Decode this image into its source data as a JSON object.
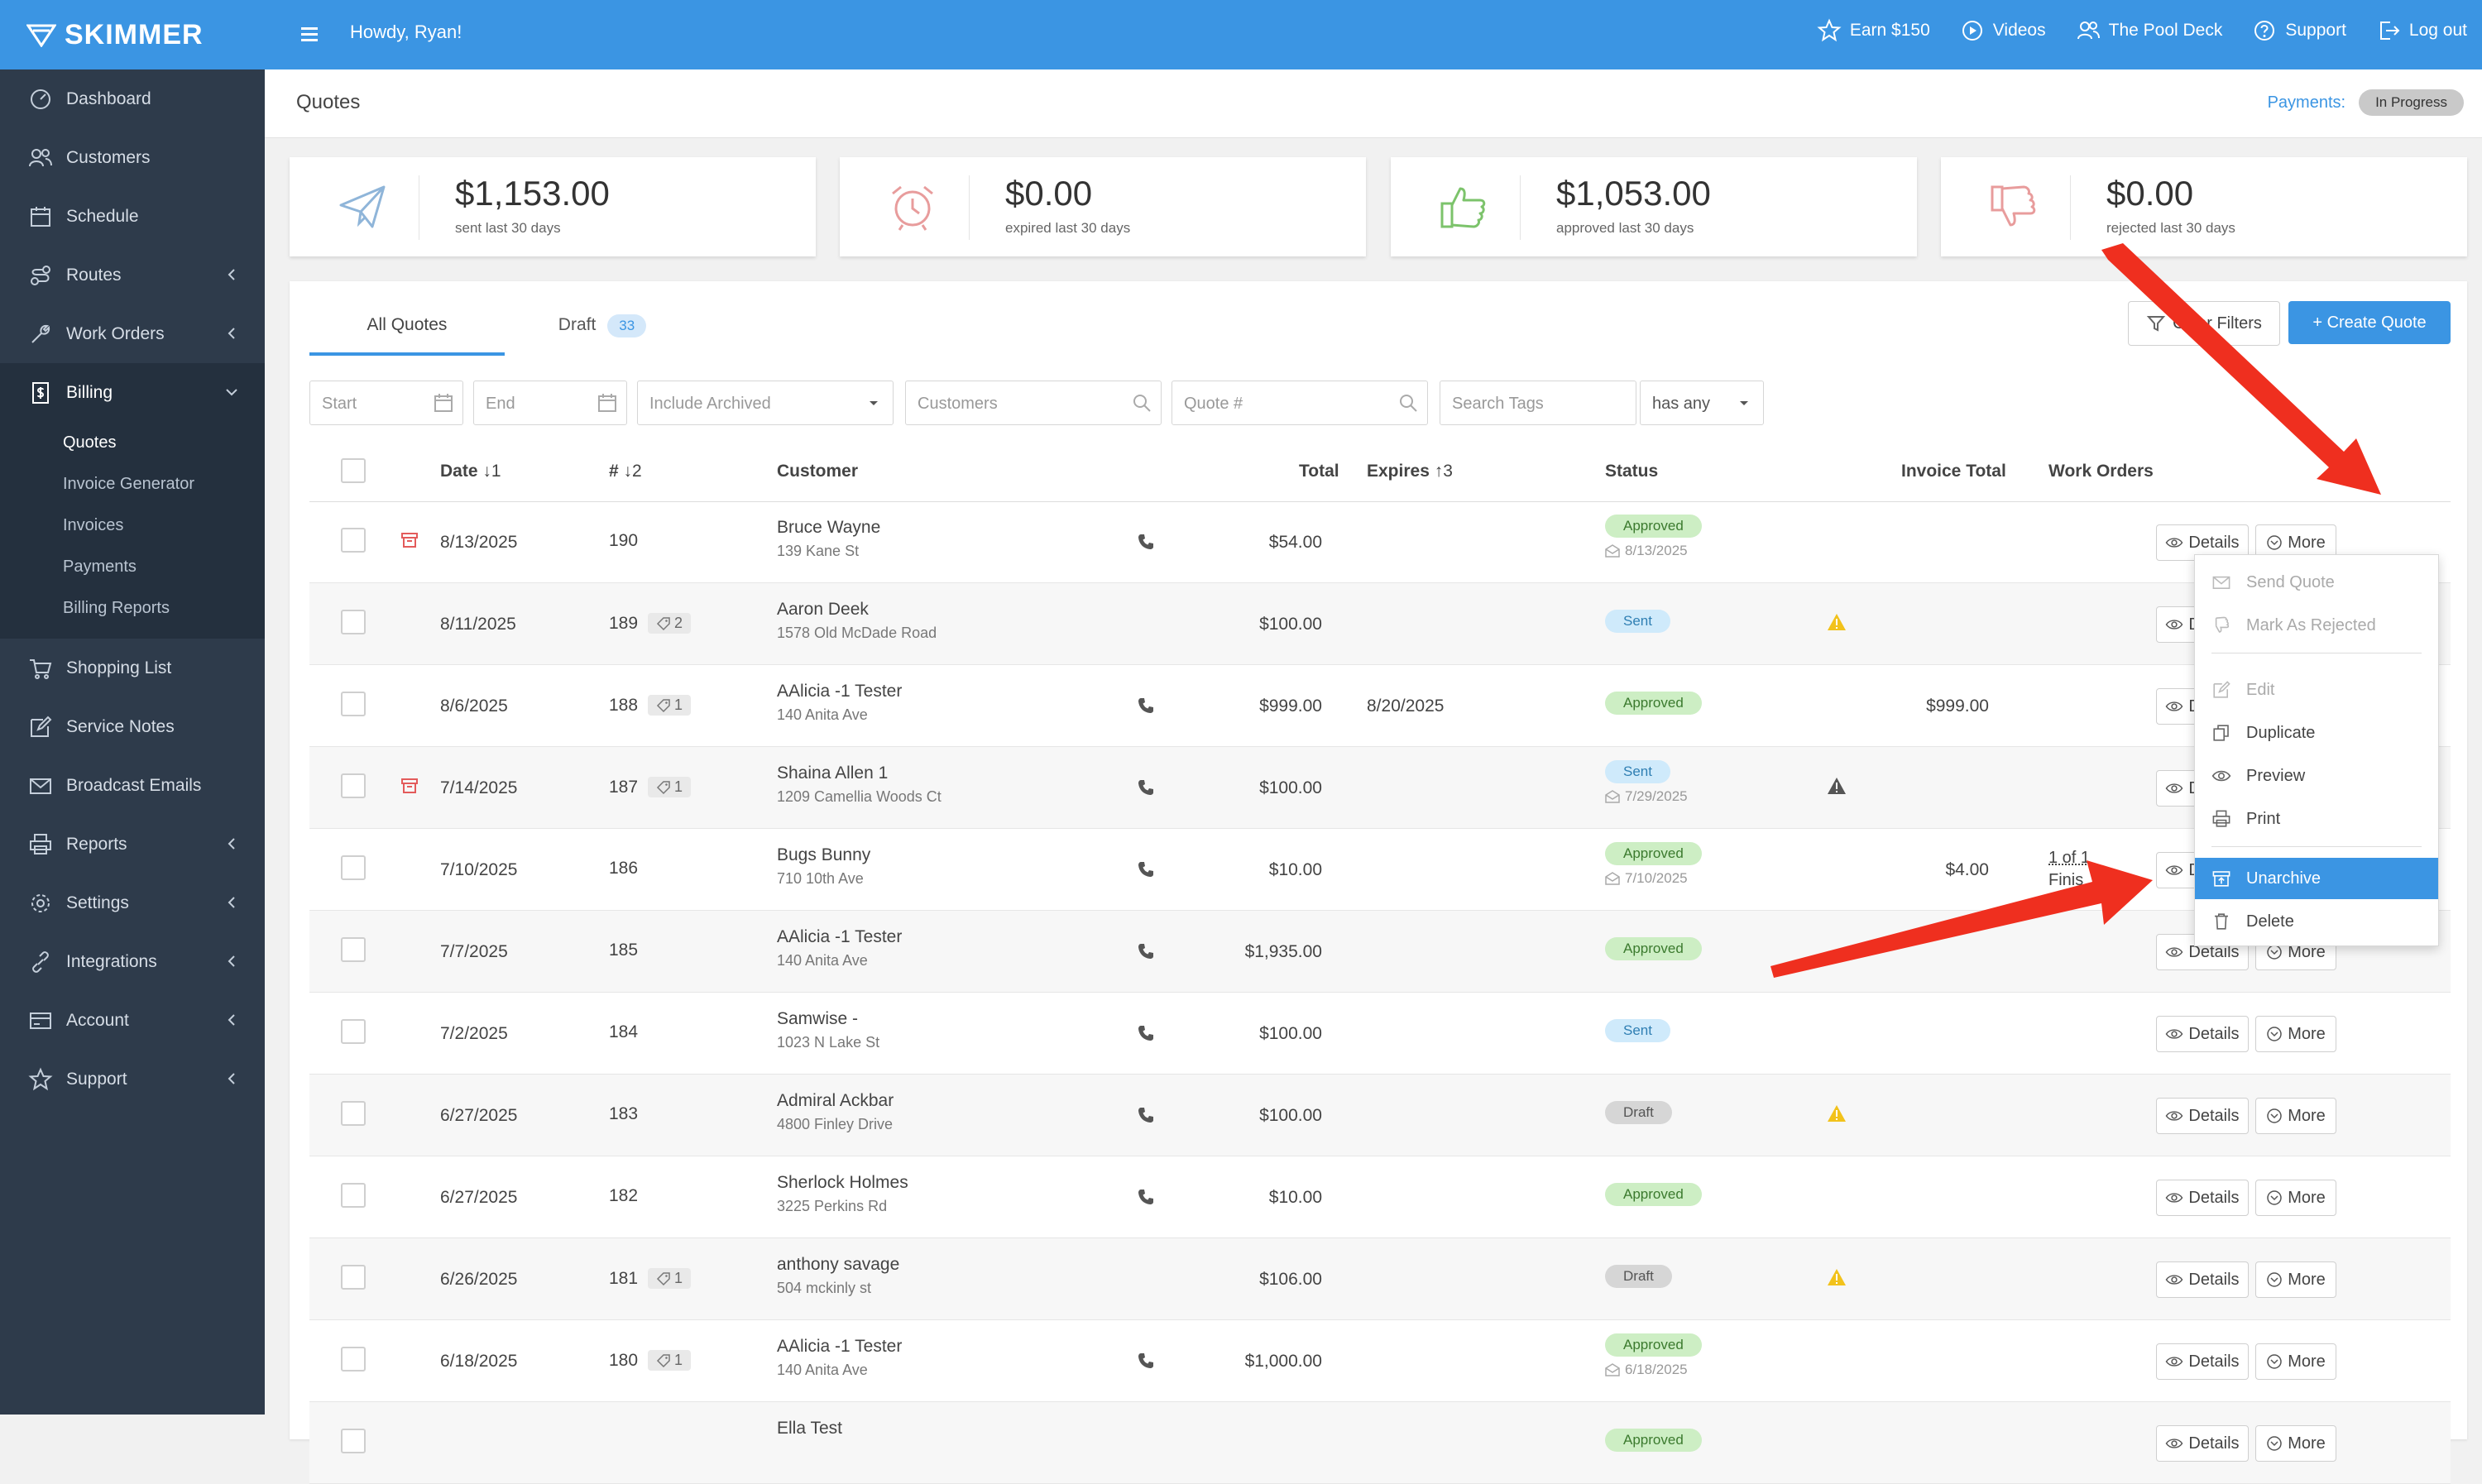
{
  "brand": {
    "name": "SKIMMER",
    "accent": "#3b95e3"
  },
  "sidebar": {
    "items": [
      {
        "label": "Dashboard",
        "icon": "dashboard-icon",
        "chevron": false
      },
      {
        "label": "Customers",
        "icon": "customers-icon",
        "chevron": false
      },
      {
        "label": "Schedule",
        "icon": "calendar-icon",
        "chevron": false
      },
      {
        "label": "Routes",
        "icon": "routes-icon",
        "chevron": true
      },
      {
        "label": "Work Orders",
        "icon": "wrench-icon",
        "chevron": true
      },
      {
        "label": "Billing",
        "icon": "billing-icon",
        "chevron": true,
        "expanded": true
      },
      {
        "label": "Shopping List",
        "icon": "cart-icon",
        "chevron": false
      },
      {
        "label": "Service Notes",
        "icon": "notes-icon",
        "chevron": false
      },
      {
        "label": "Broadcast Emails",
        "icon": "envelope-icon",
        "chevron": false
      },
      {
        "label": "Reports",
        "icon": "printer-icon",
        "chevron": true
      },
      {
        "label": "Settings",
        "icon": "gear-icon",
        "chevron": true
      },
      {
        "label": "Integrations",
        "icon": "link-icon",
        "chevron": true
      },
      {
        "label": "Account",
        "icon": "card-icon",
        "chevron": true
      },
      {
        "label": "Support",
        "icon": "star-icon",
        "chevron": true
      }
    ],
    "billing_sub": [
      "Quotes",
      "Invoice Generator",
      "Invoices",
      "Payments",
      "Billing Reports"
    ]
  },
  "topbar": {
    "greeting": "Howdy, Ryan!",
    "links": [
      "Earn $150",
      "Videos",
      "The Pool Deck",
      "Support",
      "Log out"
    ]
  },
  "page": {
    "title": "Quotes",
    "payments_label": "Payments:",
    "payments_status": "In Progress"
  },
  "stats": [
    {
      "amount": "$1,153.00",
      "label": "sent last 30 days",
      "icon": "paper-plane-icon",
      "color": "#8fb5d9"
    },
    {
      "amount": "$0.00",
      "label": "expired last 30 days",
      "icon": "alarm-clock-icon",
      "color": "#e89c9c"
    },
    {
      "amount": "$1,053.00",
      "label": "approved last 30 days",
      "icon": "thumbs-up-icon",
      "color": "#7cc36b"
    },
    {
      "amount": "$0.00",
      "label": "rejected last 30 days",
      "icon": "thumbs-down-icon",
      "color": "#e89c9c"
    }
  ],
  "tabs": {
    "all": "All Quotes",
    "draft": "Draft",
    "draft_count": "33"
  },
  "actions": {
    "clear_filters": "Clear Filters",
    "create_quote": "+ Create Quote"
  },
  "filters": {
    "start": "Start",
    "end": "End",
    "archived": "Include Archived",
    "customers": "Customers",
    "quote_no": "Quote #",
    "tags": "Search Tags",
    "tag_mode": "has any"
  },
  "table": {
    "headers": {
      "date": "Date",
      "date_sort": "↓1",
      "num": "#",
      "num_sort": "↓2",
      "customer": "Customer",
      "total": "Total",
      "expires": "Expires",
      "expires_sort": "↑3",
      "status": "Status",
      "invoice_total": "Invoice Total",
      "work_orders": "Work Orders"
    },
    "details_label": "Details",
    "more_label": "More",
    "rows": [
      {
        "date": "8/13/2025",
        "num": "190",
        "tags": "",
        "name": "Bruce Wayne",
        "addr": "139 Kane St",
        "phone": true,
        "total": "$54.00",
        "expires": "",
        "status": "Approved",
        "sent": "8/13/2025",
        "warn": "",
        "inv": "",
        "wo": "",
        "archived": true
      },
      {
        "date": "8/11/2025",
        "num": "189",
        "tags": "2",
        "name": "Aaron Deek",
        "addr": "1578 Old McDade Road",
        "phone": false,
        "total": "$100.00",
        "expires": "",
        "status": "Sent",
        "sent": "",
        "warn": "yellow",
        "inv": "",
        "wo": "",
        "archived": false
      },
      {
        "date": "8/6/2025",
        "num": "188",
        "tags": "1",
        "name": "AAlicia -1 Tester",
        "addr": "140 Anita Ave",
        "phone": true,
        "total": "$999.00",
        "expires": "8/20/2025",
        "status": "Approved",
        "sent": "",
        "warn": "",
        "inv": "$999.00",
        "wo": "",
        "archived": false
      },
      {
        "date": "7/14/2025",
        "num": "187",
        "tags": "1",
        "name": "Shaina Allen 1",
        "addr": "1209 Camellia Woods Ct",
        "phone": true,
        "total": "$100.00",
        "expires": "",
        "status": "Sent",
        "sent": "7/29/2025",
        "warn": "dark",
        "inv": "",
        "wo": "",
        "archived": true
      },
      {
        "date": "7/10/2025",
        "num": "186",
        "tags": "",
        "name": "Bugs Bunny",
        "addr": "710 10th Ave",
        "phone": true,
        "total": "$10.00",
        "expires": "",
        "status": "Approved",
        "sent": "7/10/2025",
        "warn": "",
        "inv": "$4.00",
        "wo": "1 of 1",
        "wo2": "Finis",
        "archived": false
      },
      {
        "date": "7/7/2025",
        "num": "185",
        "tags": "",
        "name": "AAlicia -1 Tester",
        "addr": "140 Anita Ave",
        "phone": true,
        "total": "$1,935.00",
        "expires": "",
        "status": "Approved",
        "sent": "",
        "warn": "",
        "inv": "",
        "wo": "",
        "archived": false
      },
      {
        "date": "7/2/2025",
        "num": "184",
        "tags": "",
        "name": "Samwise -",
        "addr": "1023 N Lake St",
        "phone": true,
        "total": "$100.00",
        "expires": "",
        "status": "Sent",
        "sent": "",
        "warn": "",
        "inv": "",
        "wo": "",
        "archived": false
      },
      {
        "date": "6/27/2025",
        "num": "183",
        "tags": "",
        "name": "Admiral Ackbar",
        "addr": "4800 Finley Drive",
        "phone": true,
        "total": "$100.00",
        "expires": "",
        "status": "Draft",
        "sent": "",
        "warn": "yellow",
        "inv": "",
        "wo": "",
        "archived": false
      },
      {
        "date": "6/27/2025",
        "num": "182",
        "tags": "",
        "name": "Sherlock Holmes",
        "addr": "3225 Perkins Rd",
        "phone": true,
        "total": "$10.00",
        "expires": "",
        "status": "Approved",
        "sent": "",
        "warn": "",
        "inv": "",
        "wo": "",
        "archived": false
      },
      {
        "date": "6/26/2025",
        "num": "181",
        "tags": "1",
        "name": "anthony savage",
        "addr": "504 mckinly st",
        "phone": false,
        "total": "$106.00",
        "expires": "",
        "status": "Draft",
        "sent": "",
        "warn": "yellow",
        "inv": "",
        "wo": "",
        "archived": false
      },
      {
        "date": "6/18/2025",
        "num": "180",
        "tags": "1",
        "name": "AAlicia -1 Tester",
        "addr": "140 Anita Ave",
        "phone": true,
        "total": "$1,000.00",
        "expires": "",
        "status": "Approved",
        "sent": "6/18/2025",
        "warn": "",
        "inv": "",
        "wo": "",
        "archived": false
      },
      {
        "date": "",
        "num": "",
        "tags": "",
        "name": "Ella Test",
        "addr": "",
        "phone": false,
        "total": "",
        "expires": "",
        "status": "Approved",
        "sent": "",
        "warn": "",
        "inv": "",
        "wo": "",
        "archived": false
      }
    ]
  },
  "more_menu": {
    "items": [
      {
        "label": "Send Quote",
        "icon": "envelope-icon",
        "disabled": true
      },
      {
        "label": "Mark As Rejected",
        "icon": "thumbs-down-icon",
        "disabled": true
      },
      {
        "label": "Edit",
        "icon": "edit-icon",
        "disabled": true
      },
      {
        "label": "Duplicate",
        "icon": "duplicate-icon",
        "disabled": false
      },
      {
        "label": "Preview",
        "icon": "eye-icon",
        "disabled": false
      },
      {
        "label": "Print",
        "icon": "printer-icon",
        "disabled": false
      },
      {
        "label": "Unarchive",
        "icon": "unarchive-icon",
        "disabled": false,
        "highlighted": true
      },
      {
        "label": "Delete",
        "icon": "trash-icon",
        "disabled": false
      }
    ]
  },
  "annotation_color": "#ef2f1f"
}
